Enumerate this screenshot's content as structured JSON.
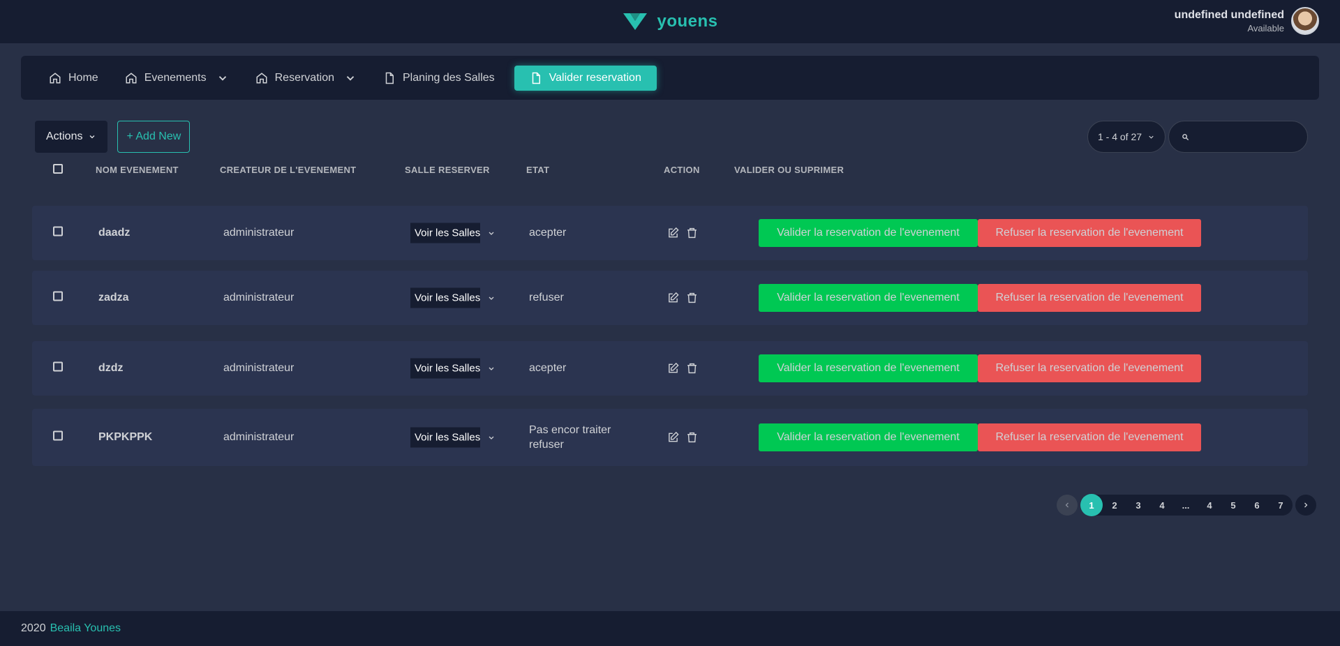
{
  "header": {
    "brand": "youens",
    "user_name": "undefined undefined",
    "user_status": "Available"
  },
  "nav": [
    {
      "label": "Home",
      "icon": "home-icon",
      "dropdown": false
    },
    {
      "label": "Evenements",
      "icon": "home-icon",
      "dropdown": true
    },
    {
      "label": "Reservation",
      "icon": "home-icon",
      "dropdown": true
    },
    {
      "label": "Planing des Salles",
      "icon": "file-icon",
      "dropdown": false
    },
    {
      "label": "Valider reservation",
      "icon": "file-icon",
      "dropdown": false,
      "active": true
    }
  ],
  "toolbar": {
    "actions_label": "Actions",
    "add_new_label": "+ Add New",
    "range_label": "1 - 4 of 27",
    "search_placeholder": ""
  },
  "table": {
    "columns": [
      "NOM EVENEMENT",
      "CREATEUR DE L'EVENEMENT",
      "SALLE RESERVER",
      "ETAT",
      "ACTION",
      "VALIDER OU SUPRIMER"
    ],
    "rows": [
      {
        "name": "daadz",
        "creator": "administrateur",
        "salle": "Voir les Salles",
        "etat": "acepter",
        "etat2": ""
      },
      {
        "name": "zadza",
        "creator": "administrateur",
        "salle": "Voir les Salles",
        "etat": "refuser",
        "etat2": ""
      },
      {
        "name": "dzdz",
        "creator": "administrateur",
        "salle": "Voir les Salles",
        "etat": "acepter",
        "etat2": ""
      },
      {
        "name": "PKPKPPK",
        "creator": "administrateur",
        "salle": "Voir les Salles",
        "etat": "Pas encor traiter",
        "etat2": "refuser"
      }
    ],
    "validate_label": "Valider la reservation de l'evenement",
    "refuse_label": "Refuser la reservation de l'evenement"
  },
  "pagination": {
    "pages": [
      "1",
      "2",
      "3",
      "4",
      "...",
      "4",
      "5",
      "6",
      "7"
    ],
    "active": "1"
  },
  "footer": {
    "year": "2020",
    "author": "Beaila Younes"
  },
  "colors": {
    "accent": "#28c0b0",
    "success": "#00c853",
    "danger": "#ea5455",
    "background": "#283046",
    "dark": "#161d31"
  }
}
